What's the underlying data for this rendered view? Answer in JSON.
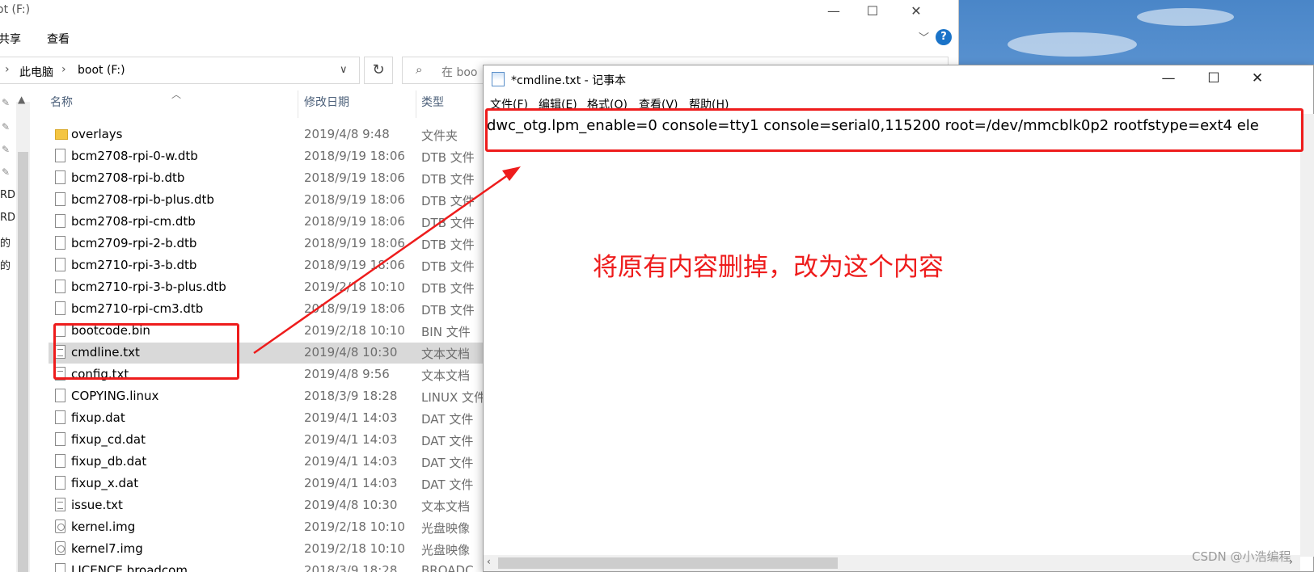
{
  "explorer": {
    "title_fragment": "ot (F:)",
    "ribbon": {
      "share": "共享",
      "view": "查看"
    },
    "address": {
      "this_pc": "此电脑",
      "drive": "boot (F:)"
    },
    "search_placeholder": "在 boo",
    "columns": {
      "name": "名称",
      "date": "修改日期",
      "type": "类型"
    },
    "nav_fragments": [
      "RD",
      "RD",
      "的",
      "的"
    ],
    "files": [
      {
        "name": "overlays",
        "date": "2019/4/8 9:48",
        "type": "文件夹",
        "icon": "folder-icon"
      },
      {
        "name": "bcm2708-rpi-0-w.dtb",
        "date": "2018/9/19 18:06",
        "type": "DTB 文件",
        "icon": "file-icon"
      },
      {
        "name": "bcm2708-rpi-b.dtb",
        "date": "2018/9/19 18:06",
        "type": "DTB 文件",
        "icon": "file-icon"
      },
      {
        "name": "bcm2708-rpi-b-plus.dtb",
        "date": "2018/9/19 18:06",
        "type": "DTB 文件",
        "icon": "file-icon"
      },
      {
        "name": "bcm2708-rpi-cm.dtb",
        "date": "2018/9/19 18:06",
        "type": "DTB 文件",
        "icon": "file-icon"
      },
      {
        "name": "bcm2709-rpi-2-b.dtb",
        "date": "2018/9/19 18:06",
        "type": "DTB 文件",
        "icon": "file-icon"
      },
      {
        "name": "bcm2710-rpi-3-b.dtb",
        "date": "2018/9/19 18:06",
        "type": "DTB 文件",
        "icon": "file-icon"
      },
      {
        "name": "bcm2710-rpi-3-b-plus.dtb",
        "date": "2019/2/18 10:10",
        "type": "DTB 文件",
        "icon": "file-icon"
      },
      {
        "name": "bcm2710-rpi-cm3.dtb",
        "date": "2018/9/19 18:06",
        "type": "DTB 文件",
        "icon": "file-icon"
      },
      {
        "name": "bootcode.bin",
        "date": "2019/2/18 10:10",
        "type": "BIN 文件",
        "icon": "file-icon"
      },
      {
        "name": "cmdline.txt",
        "date": "2019/4/8 10:30",
        "type": "文本文档",
        "icon": "text-file-icon",
        "selected": true
      },
      {
        "name": "config.txt",
        "date": "2019/4/8 9:56",
        "type": "文本文档",
        "icon": "text-file-icon"
      },
      {
        "name": "COPYING.linux",
        "date": "2018/3/9 18:28",
        "type": "LINUX 文件",
        "icon": "file-icon"
      },
      {
        "name": "fixup.dat",
        "date": "2019/4/1 14:03",
        "type": "DAT 文件",
        "icon": "file-icon"
      },
      {
        "name": "fixup_cd.dat",
        "date": "2019/4/1 14:03",
        "type": "DAT 文件",
        "icon": "file-icon"
      },
      {
        "name": "fixup_db.dat",
        "date": "2019/4/1 14:03",
        "type": "DAT 文件",
        "icon": "file-icon"
      },
      {
        "name": "fixup_x.dat",
        "date": "2019/4/1 14:03",
        "type": "DAT 文件",
        "icon": "file-icon"
      },
      {
        "name": "issue.txt",
        "date": "2019/4/8 10:30",
        "type": "文本文档",
        "icon": "text-file-icon"
      },
      {
        "name": "kernel.img",
        "date": "2019/2/18 10:10",
        "type": "光盘映像",
        "icon": "disc-image-icon"
      },
      {
        "name": "kernel7.img",
        "date": "2019/2/18 10:10",
        "type": "光盘映像",
        "icon": "disc-image-icon"
      },
      {
        "name": "LICENCE.broadcom",
        "date": "2018/3/9 18:28",
        "type": "BROADC",
        "icon": "file-icon"
      }
    ]
  },
  "notepad": {
    "title": "*cmdline.txt - 记事本",
    "menu": [
      "文件(F)",
      "编辑(E)",
      "格式(O)",
      "查看(V)",
      "帮助(H)"
    ],
    "content": "dwc_otg.lpm_enable=0 console=tty1 console=serial0,115200 root=/dev/mmcblk0p2 rootfstype=ext4 ele"
  },
  "annotation": {
    "text": "将原有内容删掉，改为这个内容",
    "color": "#ee1c1c"
  },
  "watermark": "CSDN @小浩编程"
}
